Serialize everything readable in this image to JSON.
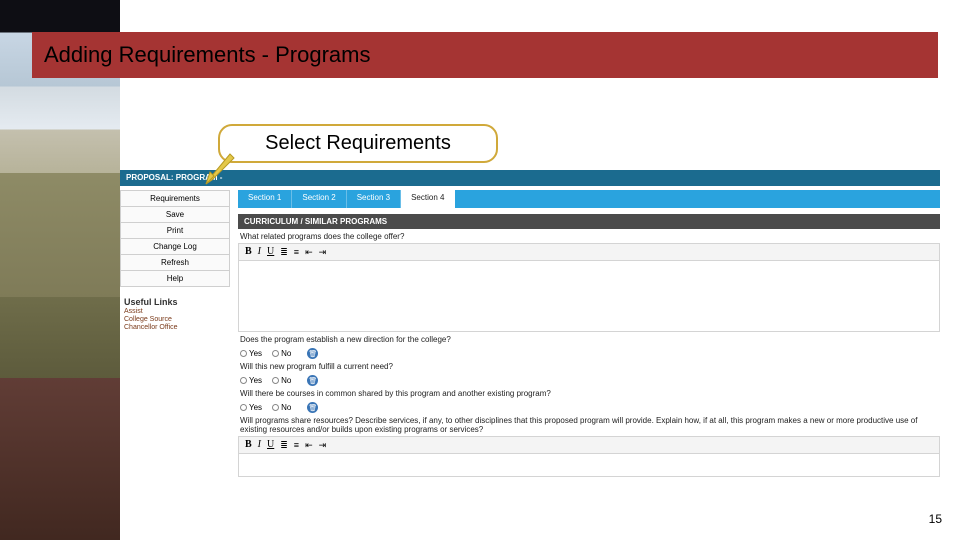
{
  "slide": {
    "title": "Adding Requirements - Programs",
    "callout": "Select Requirements",
    "page_number": "15"
  },
  "app": {
    "proposal_bar": "PROPOSAL: PROGRAM -",
    "sidebar": {
      "items": [
        "Requirements",
        "Save",
        "Print",
        "Change Log",
        "Refresh",
        "Help"
      ]
    },
    "useful_links": {
      "header": "Useful Links",
      "items": [
        "Assist",
        "College Source",
        "Chancellor Office"
      ]
    },
    "tabs": [
      "Section 1",
      "Section 2",
      "Section 3",
      "Section 4"
    ],
    "active_tab_index": 3,
    "section_header": "CURRICULUM / SIMILAR PROGRAMS",
    "questions": {
      "q1": "What related programs does the college offer?",
      "q2": "Does the program establish a new direction for the college?",
      "q3": "Will this new program fulfill a current need?",
      "q4": "Will there be courses in common shared by this program and another existing program?",
      "q5": "Will programs share resources? Describe services, if any, to other disciplines that this proposed program will provide. Explain how, if at all, this program makes a new or more productive use of existing resources and/or builds upon existing programs or services?"
    },
    "radio": {
      "yes": "Yes",
      "no": "No"
    },
    "toolbar": {
      "bold": "B",
      "italic": "I",
      "underline": "U",
      "bullets": "≣",
      "numbers": "≡",
      "outdent": "⇤",
      "indent": "⇥"
    },
    "icons": {
      "trash": "🗑"
    }
  }
}
